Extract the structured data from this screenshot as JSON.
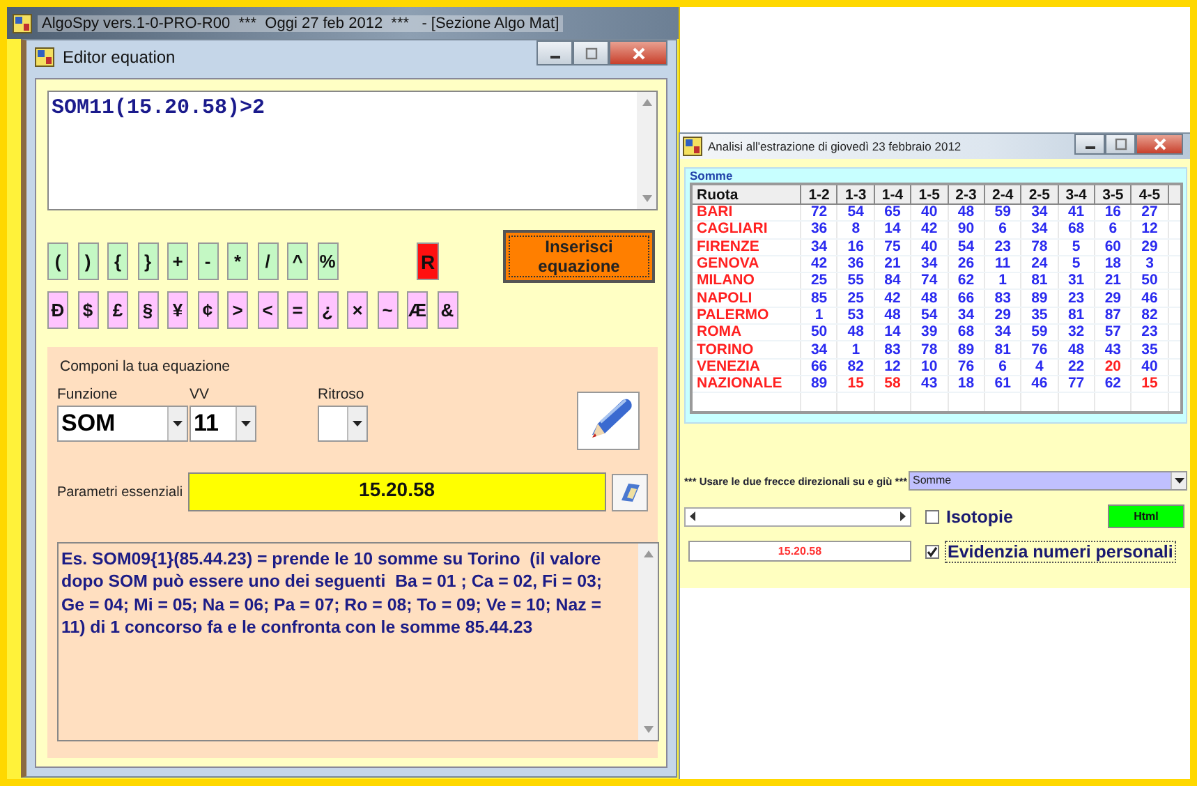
{
  "app": {
    "title": "AlgoSpy vers.1-0-PRO-R00  ***  Oggi 27 feb 2012  ***   - [Sezione Algo Mat]"
  },
  "editor": {
    "title": "Editor equation",
    "equation": "SOM11(15.20.58)>2",
    "key_rows": [
      {
        "kind": "operator",
        "keys": [
          "(",
          ")",
          "{",
          "}",
          "+",
          "-",
          "*",
          "/",
          "^",
          "%"
        ]
      },
      {
        "kind": "symbol",
        "keys": [
          "Ð",
          "$",
          "£",
          "§",
          "¥",
          "¢",
          ">",
          "<",
          "=",
          "¿",
          "×",
          "~",
          "Æ",
          "&"
        ]
      }
    ],
    "reset_key": "R",
    "insert_button": "Inserisci equazione",
    "compose": {
      "legend": "Componi la tua equazione",
      "funzione": {
        "label": "Funzione",
        "value": "SOM"
      },
      "vv": {
        "label": "VV",
        "value": "11"
      },
      "ritroso": {
        "label": "Ritroso"
      },
      "parametri": {
        "label": "Parametri essenziali",
        "value": "15.20.58"
      },
      "description": "Es. SOM09{1}(85.44.23) = prende le 10 somme su Torino  (il valore dopo SOM può essere uno dei seguenti  Ba = 01 ; Ca = 02, Fi = 03; Ge = 04; Mi = 05; Na = 06; Pa = 07; Ro = 08; To = 09; Ve = 10; Naz = 11) di 1 concorso fa e le confronta con le somme 85.44.23"
    }
  },
  "analysis": {
    "title": "Analisi all'estrazione di giovedì 23 febbraio 2012",
    "group": "Somme",
    "columns": [
      "Ruota",
      "1-2",
      "1-3",
      "1-4",
      "1-5",
      "2-3",
      "2-4",
      "2-5",
      "3-4",
      "3-5",
      "4-5"
    ],
    "rows": [
      {
        "cells": [
          {
            "text": "BARI"
          },
          {
            "text": "72",
            "highlighted": false
          },
          {
            "text": "54",
            "highlighted": false
          },
          {
            "text": "65",
            "highlighted": false
          },
          {
            "text": "40",
            "highlighted": false
          },
          {
            "text": "48",
            "highlighted": false
          },
          {
            "text": "59",
            "highlighted": false
          },
          {
            "text": "34",
            "highlighted": false
          },
          {
            "text": "41",
            "highlighted": false
          },
          {
            "text": "16",
            "highlighted": false
          },
          {
            "text": "27",
            "highlighted": false
          }
        ]
      },
      {
        "cells": [
          {
            "text": "CAGLIARI"
          },
          {
            "text": "36",
            "highlighted": false
          },
          {
            "text": "8",
            "highlighted": false
          },
          {
            "text": "14",
            "highlighted": false
          },
          {
            "text": "42",
            "highlighted": false
          },
          {
            "text": "90",
            "highlighted": false
          },
          {
            "text": "6",
            "highlighted": false
          },
          {
            "text": "34",
            "highlighted": false
          },
          {
            "text": "68",
            "highlighted": false
          },
          {
            "text": "6",
            "highlighted": false
          },
          {
            "text": "12",
            "highlighted": false
          }
        ]
      },
      {
        "cells": [
          {
            "text": "FIRENZE"
          },
          {
            "text": "34",
            "highlighted": false
          },
          {
            "text": "16",
            "highlighted": false
          },
          {
            "text": "75",
            "highlighted": false
          },
          {
            "text": "40",
            "highlighted": false
          },
          {
            "text": "54",
            "highlighted": false
          },
          {
            "text": "23",
            "highlighted": false
          },
          {
            "text": "78",
            "highlighted": false
          },
          {
            "text": "5",
            "highlighted": false
          },
          {
            "text": "60",
            "highlighted": false
          },
          {
            "text": "29",
            "highlighted": false
          }
        ]
      },
      {
        "cells": [
          {
            "text": "GENOVA"
          },
          {
            "text": "42",
            "highlighted": false
          },
          {
            "text": "36",
            "highlighted": false
          },
          {
            "text": "21",
            "highlighted": false
          },
          {
            "text": "34",
            "highlighted": false
          },
          {
            "text": "26",
            "highlighted": false
          },
          {
            "text": "11",
            "highlighted": false
          },
          {
            "text": "24",
            "highlighted": false
          },
          {
            "text": "5",
            "highlighted": false
          },
          {
            "text": "18",
            "highlighted": false
          },
          {
            "text": "3",
            "highlighted": false
          }
        ]
      },
      {
        "cells": [
          {
            "text": "MILANO"
          },
          {
            "text": "25",
            "highlighted": false
          },
          {
            "text": "55",
            "highlighted": false
          },
          {
            "text": "84",
            "highlighted": false
          },
          {
            "text": "74",
            "highlighted": false
          },
          {
            "text": "62",
            "highlighted": false
          },
          {
            "text": "1",
            "highlighted": false
          },
          {
            "text": "81",
            "highlighted": false
          },
          {
            "text": "31",
            "highlighted": false
          },
          {
            "text": "21",
            "highlighted": false
          },
          {
            "text": "50",
            "highlighted": false
          }
        ]
      },
      {
        "cells": [
          {
            "text": "NAPOLI"
          },
          {
            "text": "85",
            "highlighted": false
          },
          {
            "text": "25",
            "highlighted": false
          },
          {
            "text": "42",
            "highlighted": false
          },
          {
            "text": "48",
            "highlighted": false
          },
          {
            "text": "66",
            "highlighted": false
          },
          {
            "text": "83",
            "highlighted": false
          },
          {
            "text": "89",
            "highlighted": false
          },
          {
            "text": "23",
            "highlighted": false
          },
          {
            "text": "29",
            "highlighted": false
          },
          {
            "text": "46",
            "highlighted": false
          }
        ]
      },
      {
        "cells": [
          {
            "text": "PALERMO"
          },
          {
            "text": "1",
            "highlighted": false
          },
          {
            "text": "53",
            "highlighted": false
          },
          {
            "text": "48",
            "highlighted": false
          },
          {
            "text": "54",
            "highlighted": false
          },
          {
            "text": "34",
            "highlighted": false
          },
          {
            "text": "29",
            "highlighted": false
          },
          {
            "text": "35",
            "highlighted": false
          },
          {
            "text": "81",
            "highlighted": false
          },
          {
            "text": "87",
            "highlighted": false
          },
          {
            "text": "82",
            "highlighted": false
          }
        ]
      },
      {
        "cells": [
          {
            "text": "ROMA"
          },
          {
            "text": "50",
            "highlighted": false
          },
          {
            "text": "48",
            "highlighted": false
          },
          {
            "text": "14",
            "highlighted": false
          },
          {
            "text": "39",
            "highlighted": false
          },
          {
            "text": "68",
            "highlighted": false
          },
          {
            "text": "34",
            "highlighted": false
          },
          {
            "text": "59",
            "highlighted": false
          },
          {
            "text": "32",
            "highlighted": false
          },
          {
            "text": "57",
            "highlighted": false
          },
          {
            "text": "23",
            "highlighted": false
          }
        ]
      },
      {
        "cells": [
          {
            "text": "TORINO"
          },
          {
            "text": "34",
            "highlighted": false
          },
          {
            "text": "1",
            "highlighted": false
          },
          {
            "text": "83",
            "highlighted": false
          },
          {
            "text": "78",
            "highlighted": false
          },
          {
            "text": "89",
            "highlighted": false
          },
          {
            "text": "81",
            "highlighted": false
          },
          {
            "text": "76",
            "highlighted": false
          },
          {
            "text": "48",
            "highlighted": false
          },
          {
            "text": "43",
            "highlighted": false
          },
          {
            "text": "35",
            "highlighted": false
          }
        ]
      },
      {
        "cells": [
          {
            "text": "VENEZIA"
          },
          {
            "text": "66",
            "highlighted": false
          },
          {
            "text": "82",
            "highlighted": false
          },
          {
            "text": "12",
            "highlighted": false
          },
          {
            "text": "10",
            "highlighted": false
          },
          {
            "text": "76",
            "highlighted": false
          },
          {
            "text": "6",
            "highlighted": false
          },
          {
            "text": "4",
            "highlighted": false
          },
          {
            "text": "22",
            "highlighted": false
          },
          {
            "text": "20",
            "highlighted": true
          },
          {
            "text": "40",
            "highlighted": false
          }
        ]
      },
      {
        "cells": [
          {
            "text": "NAZIONALE"
          },
          {
            "text": "89",
            "highlighted": false
          },
          {
            "text": "15",
            "highlighted": true
          },
          {
            "text": "58",
            "highlighted": true
          },
          {
            "text": "43",
            "highlighted": false
          },
          {
            "text": "18",
            "highlighted": false
          },
          {
            "text": "61",
            "highlighted": false
          },
          {
            "text": "46",
            "highlighted": false
          },
          {
            "text": "77",
            "highlighted": false
          },
          {
            "text": "62",
            "highlighted": false
          },
          {
            "text": "15",
            "highlighted": true
          }
        ]
      }
    ],
    "hint": "*** Usare le due frecce direzionali su e giù ***",
    "view": "Somme",
    "isotopie": {
      "label": "Isotopie",
      "checked": false
    },
    "html_button": "Html",
    "numbers": "15.20.58",
    "evidenzia": {
      "label": "Evidenzia numeri personali",
      "checked": true
    }
  }
}
